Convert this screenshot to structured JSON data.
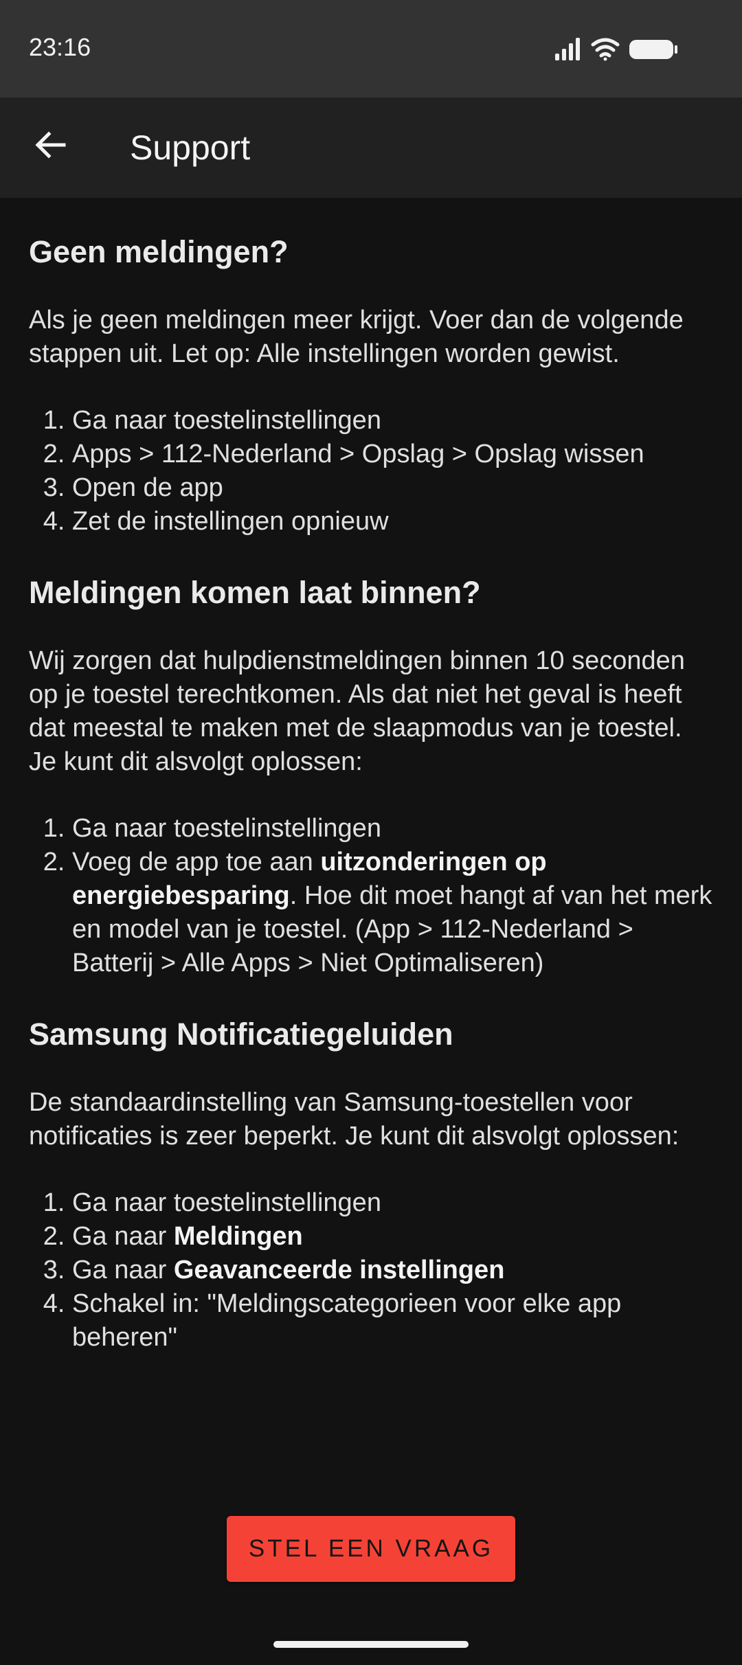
{
  "status_bar": {
    "time": "23:16",
    "icons": [
      "signal-icon",
      "wifi-icon",
      "battery-icon"
    ]
  },
  "app_bar": {
    "back_icon": "arrow-left-icon",
    "title": "Support"
  },
  "sections": [
    {
      "title": "Geen meldingen?",
      "text": "Als je geen meldingen meer krijgt. Voer dan de volgende stappen uit. Let op: Alle instellingen worden gewist.",
      "steps": [
        [
          {
            "t": "Ga naar toestelinstellingen"
          }
        ],
        [
          {
            "t": "Apps > 112-Nederland > Opslag > Opslag wissen"
          }
        ],
        [
          {
            "t": "Open de app"
          }
        ],
        [
          {
            "t": "Zet de instellingen opnieuw"
          }
        ]
      ]
    },
    {
      "title": "Meldingen komen laat binnen?",
      "text": "Wij zorgen dat hulpdienstmeldingen binnen 10 seconden op je toestel terechtkomen. Als dat niet het geval is heeft dat meestal te maken met de slaapmodus van je toestel. Je kunt dit alsvolgt oplossen:",
      "steps": [
        [
          {
            "t": "Ga naar toestelinstellingen"
          }
        ],
        [
          {
            "t": "Voeg de app toe aan "
          },
          {
            "t": "uitzonderingen op energiebesparing",
            "b": true
          },
          {
            "t": ". Hoe dit moet hangt af van het merk en model van je toestel. (App > 112-Nederland > Batterij > Alle Apps > Niet Optimaliseren)"
          }
        ]
      ]
    },
    {
      "title": "Samsung Notificatiegeluiden",
      "text": "De standaardinstelling van Samsung-toestellen voor notificaties is zeer beperkt. Je kunt dit alsvolgt oplossen:",
      "steps": [
        [
          {
            "t": "Ga naar toestelinstellingen"
          }
        ],
        [
          {
            "t": "Ga naar "
          },
          {
            "t": "Meldingen",
            "b": true
          }
        ],
        [
          {
            "t": "Ga naar "
          },
          {
            "t": "Geavanceerde instellingen",
            "b": true
          }
        ],
        [
          {
            "t": "Schakel in: \"Meldingscategorieen voor elke app beheren\""
          }
        ]
      ]
    }
  ],
  "ask_button": {
    "label": "STEL EEN VRAAG",
    "color": "#f44336"
  }
}
